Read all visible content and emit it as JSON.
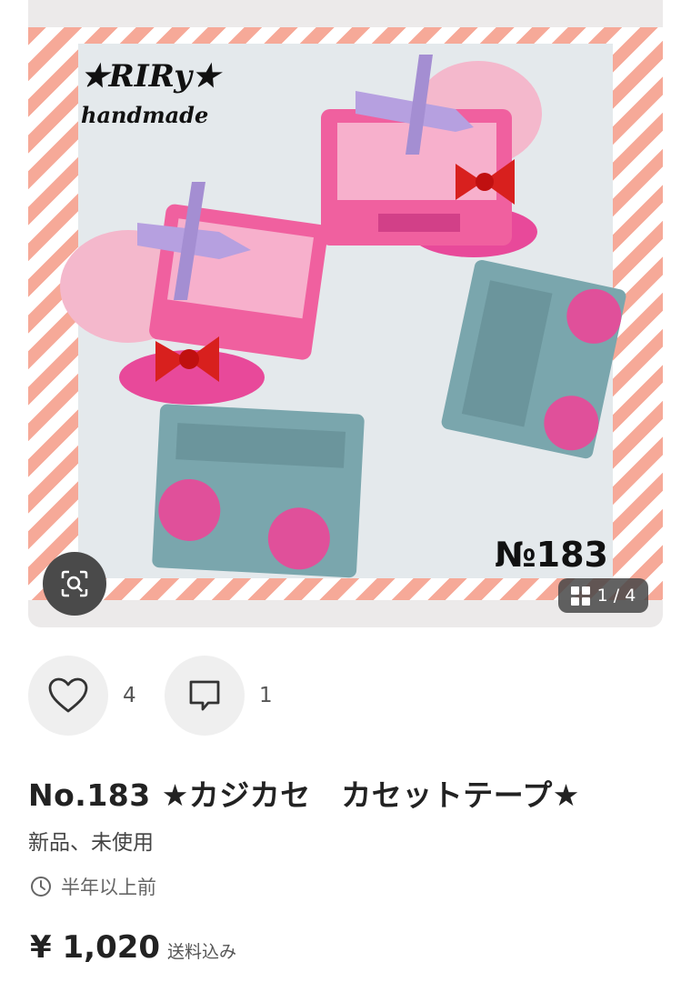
{
  "gallery": {
    "brand_line1": "★RIRy★",
    "brand_line2": "handmade",
    "item_number_overlay": "№183",
    "page_counter": "1 / 4",
    "colors": {
      "stripe": "#f6a998",
      "pink": "#ec4b9c",
      "cassette_pink": "#f0609f",
      "teal": "#7aa6ad",
      "lavender": "#b6a0e0"
    }
  },
  "actions": {
    "like_count": "4",
    "comment_count": "1"
  },
  "item": {
    "title": "No.183 ★カジカセ　カセットテープ★",
    "condition": "新品、未使用",
    "posted": "半年以上前",
    "price": "¥ 1,020",
    "shipping": "送料込み"
  }
}
